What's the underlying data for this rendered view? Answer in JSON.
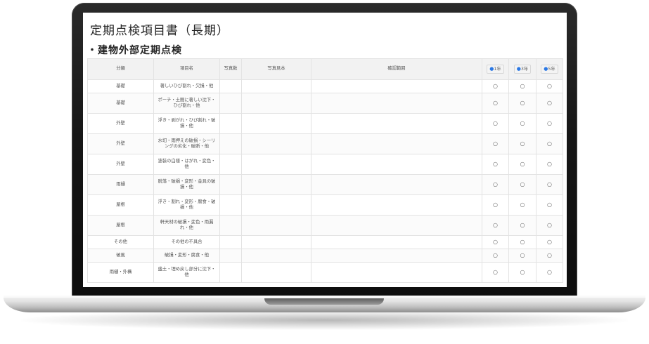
{
  "document": {
    "title": "定期点検項目書（長期）",
    "section": "・建物外部定期点検"
  },
  "table": {
    "headers": {
      "category": "分類",
      "item": "項目名",
      "photo_count": "写真数",
      "photo_sample": "写真見本",
      "check_scope": "確認範囲"
    },
    "year_columns": [
      {
        "icon": "●",
        "label": "1年"
      },
      {
        "icon": "●",
        "label": "3年"
      },
      {
        "icon": "●",
        "label": "5年"
      }
    ],
    "rows": [
      {
        "category": "基礎",
        "item": "著しいひび割れ・欠損・他",
        "marks": [
          "○",
          "○",
          "○"
        ]
      },
      {
        "category": "基礎",
        "item": "ポーチ・土間に著しい沈下・ひび割れ・他",
        "marks": [
          "○",
          "○",
          "○"
        ]
      },
      {
        "category": "外壁",
        "item": "浮き・剥がれ・ひび割れ・破損・他",
        "marks": [
          "○",
          "○",
          "○"
        ]
      },
      {
        "category": "外壁",
        "item": "水切・雨押えの破損・シーリングの劣化・破断・他",
        "marks": [
          "○",
          "○",
          "○"
        ]
      },
      {
        "category": "外壁",
        "item": "塗装の白様・はがれ・変色・他",
        "marks": [
          "○",
          "○",
          "○"
        ]
      },
      {
        "category": "雨樋",
        "item": "脱落・破損・変形・金具の破損・他",
        "marks": [
          "○",
          "○",
          "○"
        ]
      },
      {
        "category": "屋根",
        "item": "浮き・割れ・変形・腐食・破損・他",
        "marks": [
          "○",
          "○",
          "○"
        ]
      },
      {
        "category": "屋根",
        "item": "軒天材の破損・変色・雨漏れ・他",
        "marks": [
          "○",
          "○",
          "○"
        ]
      },
      {
        "category": "その他",
        "item": "その他の不具合",
        "marks": [
          "○",
          "○",
          "○"
        ]
      },
      {
        "category": "破風",
        "item": "破損・変形・腐食・他",
        "marks": [
          "○",
          "○",
          "○"
        ]
      },
      {
        "category": "雨樋・外構",
        "item": "盛土・埋め戻し部分に沈下・他",
        "marks": [
          "○",
          "○",
          "○"
        ]
      }
    ]
  }
}
